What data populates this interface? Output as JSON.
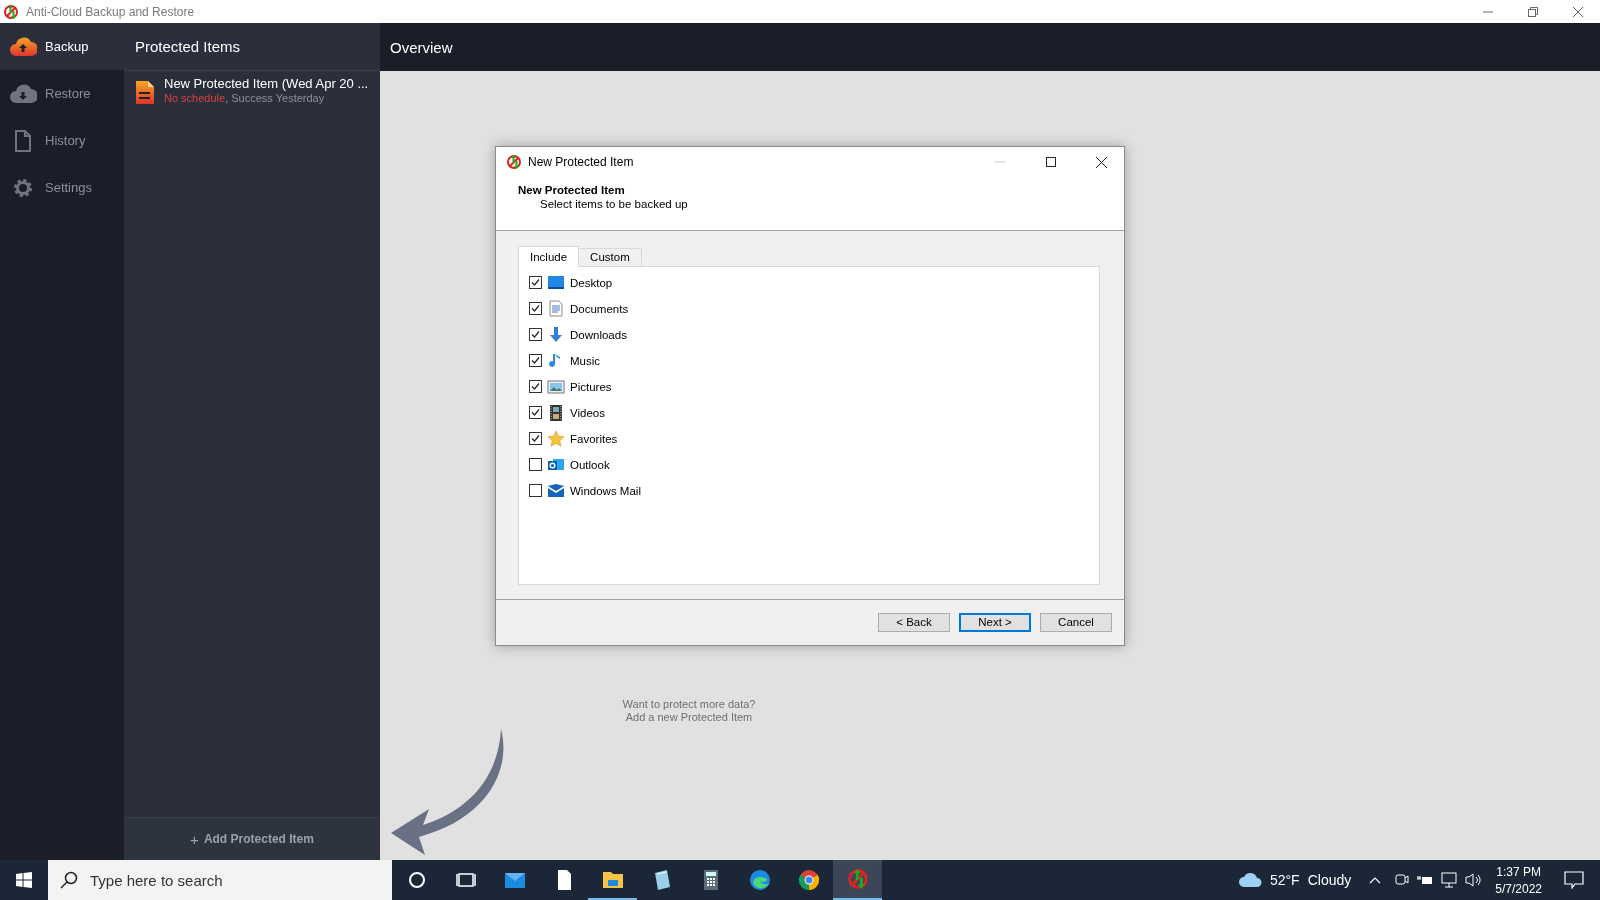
{
  "window": {
    "title": "Anti-Cloud Backup and Restore"
  },
  "nav": [
    {
      "label": "Backup",
      "kind": "backup",
      "selected": true
    },
    {
      "label": "Restore",
      "kind": "restore",
      "selected": false
    },
    {
      "label": "History",
      "kind": "history",
      "selected": false
    },
    {
      "label": "Settings",
      "kind": "settings",
      "selected": false
    }
  ],
  "protected_items": {
    "title": "Protected Items",
    "items": [
      {
        "name": "New Protected Item (Wed Apr 20 ...",
        "schedule": "No schedule",
        "status": ", Success Yesterday"
      }
    ],
    "add_icon": "+",
    "add_button": "Add Protected Item"
  },
  "overview": {
    "title": "Overview",
    "hint": [
      "Want to protect more data?",
      "Add a new Protected Item"
    ]
  },
  "dialog": {
    "title": "New Protected Item",
    "heading": "New Protected Item",
    "subheading": "Select items to be backed up",
    "tabs": [
      {
        "label": "Include",
        "selected": true
      },
      {
        "label": "Custom",
        "selected": false
      }
    ],
    "items": [
      {
        "label": "Desktop",
        "kind": "desktop",
        "checked": true
      },
      {
        "label": "Documents",
        "kind": "documents",
        "checked": true
      },
      {
        "label": "Downloads",
        "kind": "downloads",
        "checked": true
      },
      {
        "label": "Music",
        "kind": "music",
        "checked": true
      },
      {
        "label": "Pictures",
        "kind": "pictures",
        "checked": true
      },
      {
        "label": "Videos",
        "kind": "videos",
        "checked": true
      },
      {
        "label": "Favorites",
        "kind": "favorites",
        "checked": true
      },
      {
        "label": "Outlook",
        "kind": "outlook",
        "checked": false
      },
      {
        "label": "Windows Mail",
        "kind": "mail",
        "checked": false
      }
    ],
    "buttons": [
      {
        "label": "< Back",
        "kind": "normal"
      },
      {
        "label": "Next >",
        "kind": "default"
      },
      {
        "label": "Cancel",
        "kind": "normal"
      }
    ]
  },
  "taskbar": {
    "search_placeholder": "Type here to search",
    "apps": [
      {
        "kind": "cortana",
        "running": false,
        "selected": false
      },
      {
        "kind": "taskview",
        "running": false,
        "selected": false
      },
      {
        "kind": "mail",
        "running": false,
        "selected": false
      },
      {
        "kind": "file",
        "running": false,
        "selected": false
      },
      {
        "kind": "explorer",
        "running": true,
        "selected": false
      },
      {
        "kind": "notepad",
        "running": false,
        "selected": false
      },
      {
        "kind": "calculator",
        "running": false,
        "selected": false
      },
      {
        "kind": "edge",
        "running": false,
        "selected": false
      },
      {
        "kind": "chrome",
        "running": false,
        "selected": false
      },
      {
        "kind": "anticloud",
        "running": true,
        "selected": true
      }
    ],
    "temperature": "52°F",
    "weather": "Cloudy",
    "time": "1:37 PM",
    "date": "5/7/2022"
  }
}
